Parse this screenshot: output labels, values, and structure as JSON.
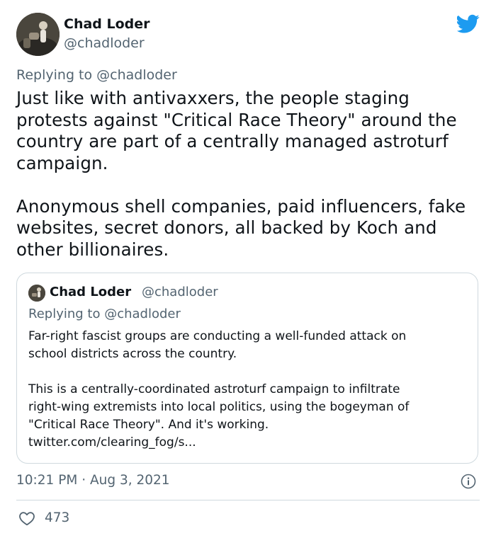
{
  "author": {
    "name": "Chad Loder",
    "handle": "@chadloder"
  },
  "tweet": {
    "replying_prefix": "Replying to ",
    "replying_to": "@chadloder",
    "text": "Just like with antivaxxers, the people staging\nprotests against \"Critical Race Theory\" around the\ncountry are part of a centrally managed astroturf\ncampaign.\n\nAnonymous shell companies, paid influencers, fake\nwebsites, secret donors, all backed by Koch and\nother billionaires.",
    "timestamp": "10:21 PM · Aug 3, 2021",
    "likes": "473"
  },
  "quoted": {
    "name": "Chad Loder",
    "handle": "@chadloder",
    "replying_prefix": "Replying to ",
    "replying_to": "@chadloder",
    "text": "Far-right fascist groups are conducting a well-funded attack on\nschool districts across the country.\n\nThis is a centrally-coordinated astroturf campaign to infiltrate\nright-wing extremists into local politics, using the bogeyman of\n\"Critical Race Theory\". And it's working.\ntwitter.com/clearing_fog/s..."
  },
  "icons": {
    "brand": "twitter-bird-icon",
    "info": "info-icon",
    "like": "heart-icon"
  },
  "colors": {
    "brand": "#1d9bf0",
    "secondary_text": "#536471",
    "primary_text": "#0f1419",
    "border": "#cfd9de"
  }
}
